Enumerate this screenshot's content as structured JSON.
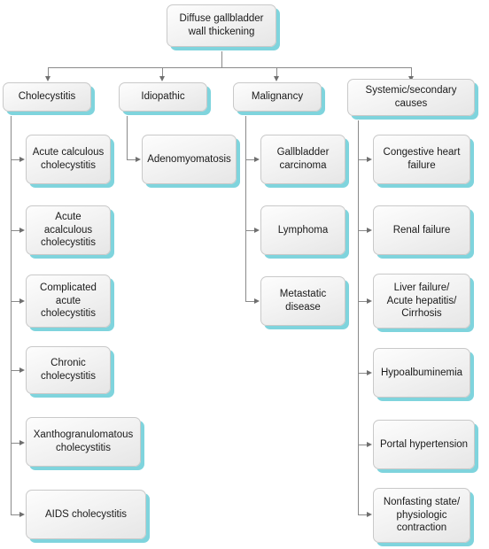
{
  "diagram": {
    "title": "Diffuse gallbladder wall thickening",
    "root": {
      "label": "Diffuse gallbladder\nwall thickening"
    },
    "colors": {
      "box_shadow_teal": "#7fd4dd",
      "box_border": "#c9c9c9",
      "box_fill_light": "#fdfdfd",
      "box_fill_dark": "#e6e6e6",
      "connector": "#8a8a8a",
      "text": "#1a1a1a",
      "background": "#ffffff"
    },
    "branches": [
      {
        "label": "Cholecystitis",
        "children": [
          {
            "label": "Acute calculous\ncholecystitis"
          },
          {
            "label": "Acute acalculous\ncholecystitis"
          },
          {
            "label": "Complicated\nacute\ncholecystitis"
          },
          {
            "label": "Chronic\ncholecystitis"
          },
          {
            "label": "Xanthogranulomatous\ncholecystitis"
          },
          {
            "label": "AIDS cholecystitis"
          }
        ]
      },
      {
        "label": "Idiopathic",
        "children": [
          {
            "label": "Adenomyomatosis"
          }
        ]
      },
      {
        "label": "Malignancy",
        "children": [
          {
            "label": "Gallbladder\ncarcinoma"
          },
          {
            "label": "Lymphoma"
          },
          {
            "label": "Metastatic\ndisease"
          }
        ]
      },
      {
        "label": "Systemic/secondary\ncauses",
        "children": [
          {
            "label": "Congestive heart\nfailure"
          },
          {
            "label": "Renal failure"
          },
          {
            "label": "Liver failure/\nAcute hepatitis/\nCirrhosis"
          },
          {
            "label": "Hypoalbuminemia"
          },
          {
            "label": "Portal hypertension"
          },
          {
            "label": "Nonfasting state/\nphysiologic\ncontraction"
          }
        ]
      }
    ]
  }
}
